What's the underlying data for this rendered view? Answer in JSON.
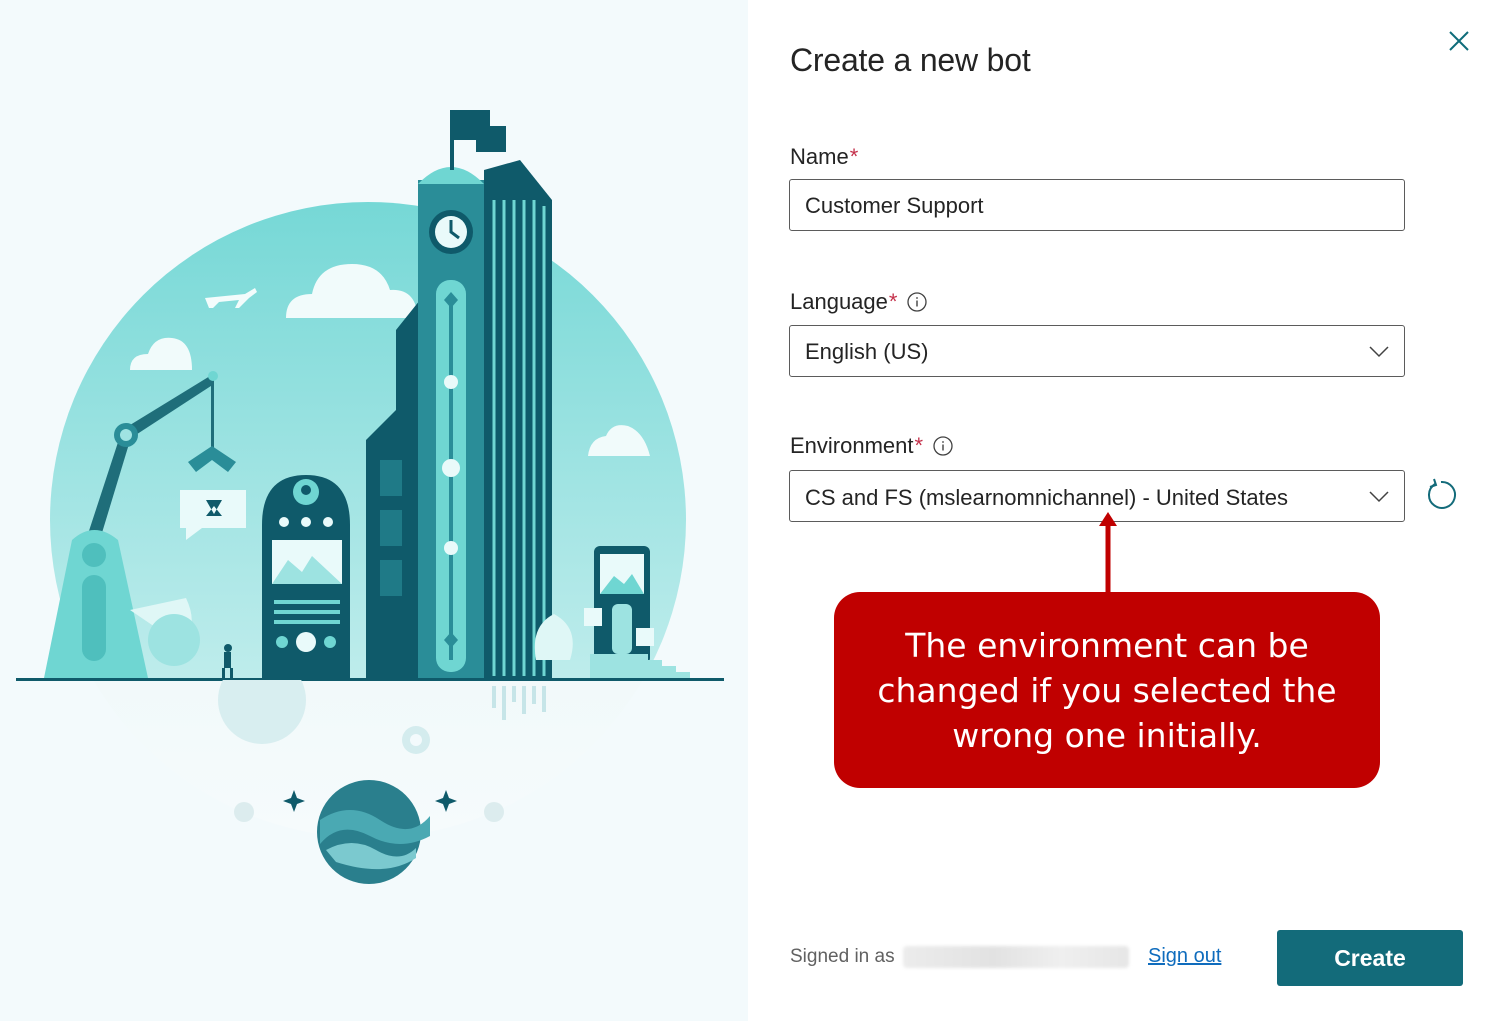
{
  "dialog": {
    "title": "Create a new bot",
    "close_icon": "close-icon"
  },
  "fields": {
    "name": {
      "label": "Name",
      "required_mark": "*",
      "value": "Customer Support"
    },
    "language": {
      "label": "Language",
      "required_mark": "*",
      "value": "English (US)",
      "info_icon": "info-icon",
      "dropdown_icon": "chevron-down-icon"
    },
    "environment": {
      "label": "Environment",
      "required_mark": "*",
      "value": "CS and FS (mslearnomnichannel) - United States",
      "info_icon": "info-icon",
      "dropdown_icon": "chevron-down-icon",
      "refresh_icon": "refresh-icon"
    }
  },
  "callout": {
    "text": "The environment can be changed if you selected the wrong one initially."
  },
  "footer": {
    "signed_in_label": "Signed in as",
    "sign_out": "Sign out",
    "create_button": "Create"
  },
  "colors": {
    "accent": "#136b7a",
    "required": "#c4314b",
    "callout": "#c00000",
    "link": "#0f6cbd",
    "illustration_teal": "#6fd6d2",
    "illustration_dark": "#0f5a6a"
  }
}
